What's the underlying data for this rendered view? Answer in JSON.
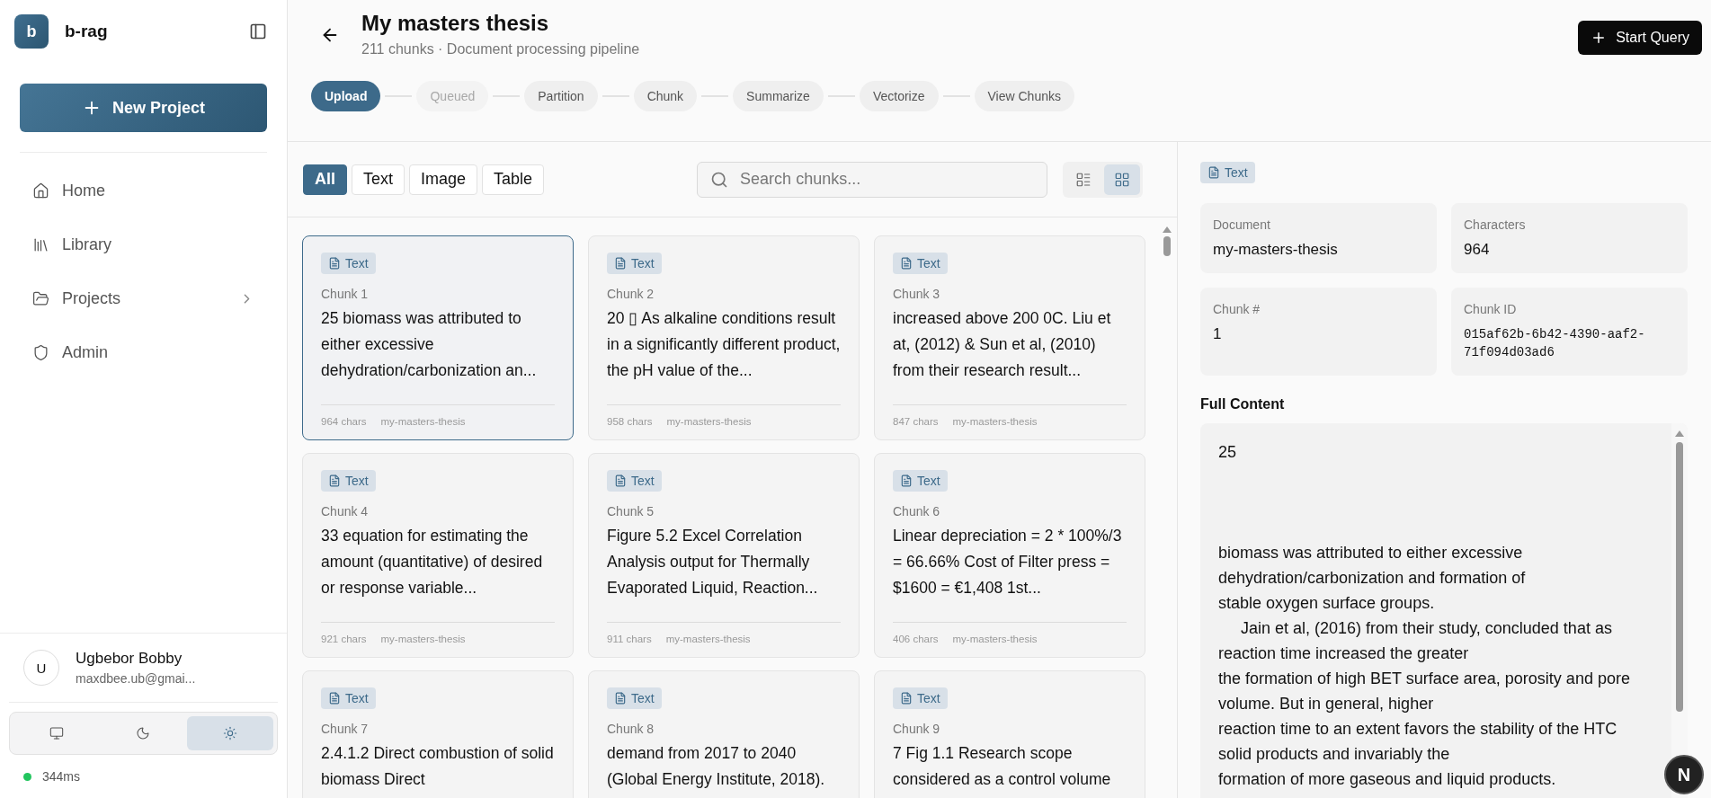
{
  "sidebar": {
    "logo": "b",
    "app_name": "b-rag",
    "new_button": "New Project",
    "nav": [
      {
        "label": "Home",
        "has_submenu": false
      },
      {
        "label": "Library",
        "has_submenu": false
      },
      {
        "label": "Projects",
        "has_submenu": true
      },
      {
        "label": "Admin",
        "has_submenu": false
      }
    ],
    "user": {
      "initial": "U",
      "name": "Ugbebor Bobby",
      "email": "maxdbee.ub@gmai..."
    },
    "theme_options": [
      {
        "selected": false
      },
      {
        "selected": false
      },
      {
        "selected": true
      }
    ],
    "status": {
      "color": "#22c55e",
      "latency": "344ms"
    }
  },
  "header": {
    "title": "My masters thesis",
    "subtitle": "211 chunks · Document processing pipeline",
    "action": "Start Query",
    "steps": [
      {
        "label": "Upload",
        "selected": true,
        "disabled": false
      },
      {
        "label": "Queued",
        "selected": false,
        "disabled": true
      },
      {
        "label": "Partition",
        "selected": false,
        "disabled": false
      },
      {
        "label": "Chunk",
        "selected": false,
        "disabled": false
      },
      {
        "label": "Summarize",
        "selected": false,
        "disabled": false
      },
      {
        "label": "Vectorize",
        "selected": false,
        "disabled": false
      },
      {
        "label": "View Chunks",
        "selected": false,
        "disabled": false
      }
    ]
  },
  "filters": [
    {
      "label": "All",
      "selected": true
    },
    {
      "label": "Text",
      "selected": false
    },
    {
      "label": "Image",
      "selected": false
    },
    {
      "label": "Table",
      "selected": false
    }
  ],
  "search": {
    "placeholder": "Search chunks..."
  },
  "view_modes": [
    {
      "kind": "list",
      "selected": false
    },
    {
      "kind": "grid",
      "selected": true
    }
  ],
  "chunks": [
    {
      "type": "Text",
      "title": "Chunk 1",
      "preview": "25 biomass was attributed to either excessive dehydration/carbonization an...",
      "chars": "964 chars",
      "document": "my-masters-thesis",
      "selected": true
    },
    {
      "type": "Text",
      "title": "Chunk 2",
      "preview": "20 ▯ As alkaline conditions result in a significantly different product, the pH value of the...",
      "chars": "958 chars",
      "document": "my-masters-thesis",
      "selected": false
    },
    {
      "type": "Text",
      "title": "Chunk 3",
      "preview": "increased above 200 0C. Liu et at, (2012) & Sun et al, (2010) from their research result...",
      "chars": "847 chars",
      "document": "my-masters-thesis",
      "selected": false
    },
    {
      "type": "Text",
      "title": "Chunk 4",
      "preview": "33 equation for estimating the amount (quantitative) of desired or response variable...",
      "chars": "921 chars",
      "document": "my-masters-thesis",
      "selected": false
    },
    {
      "type": "Text",
      "title": "Chunk 5",
      "preview": "Figure 5.2 Excel Correlation Analysis output for Thermally Evaporated Liquid, Reaction...",
      "chars": "911 chars",
      "document": "my-masters-thesis",
      "selected": false
    },
    {
      "type": "Text",
      "title": "Chunk 6",
      "preview": "Linear depreciation = 2 * 100%/3 = 66.66% Cost of Filter press = $1600 = €1,408 1st...",
      "chars": "406 chars",
      "document": "my-masters-thesis",
      "selected": false
    },
    {
      "type": "Text",
      "title": "Chunk 7",
      "preview": "2.4.1.2 Direct combustion of solid biomass Direct",
      "selected": false
    },
    {
      "type": "Text",
      "title": "Chunk 8",
      "preview": "demand from 2017 to 2040 (Global Energy Institute, 2018).",
      "selected": false
    },
    {
      "type": "Text",
      "title": "Chunk 9",
      "preview": "7 Fig 1.1 Research scope considered as a control volume",
      "selected": false
    }
  ],
  "detail": {
    "type": "Text",
    "fields": [
      {
        "label": "Document",
        "value": "my-masters-thesis",
        "kind": "plain"
      },
      {
        "label": "Characters",
        "value": "964",
        "kind": "plain"
      },
      {
        "label": "Chunk #",
        "value": "1",
        "kind": "plain"
      },
      {
        "label": "Chunk ID",
        "value": "015af62b-6b42-4390-aaf2-71f094d03ad6",
        "kind": "mono"
      }
    ],
    "content_label": "Full Content",
    "content": "25\n\n\n\nbiomass was attributed to either excessive\ndehydration/carbonization and formation of\nstable oxygen surface groups.\n     Jain et al, (2016) from their study, concluded that as\nreaction time increased the greater\nthe formation of high BET surface area, porosity and pore\nvolume. But in general, higher\nreaction time to an extent favors the stability of the HTC\nsolid products and invariably the\nformation of more gaseous and liquid products."
  },
  "dev_badge": "N"
}
